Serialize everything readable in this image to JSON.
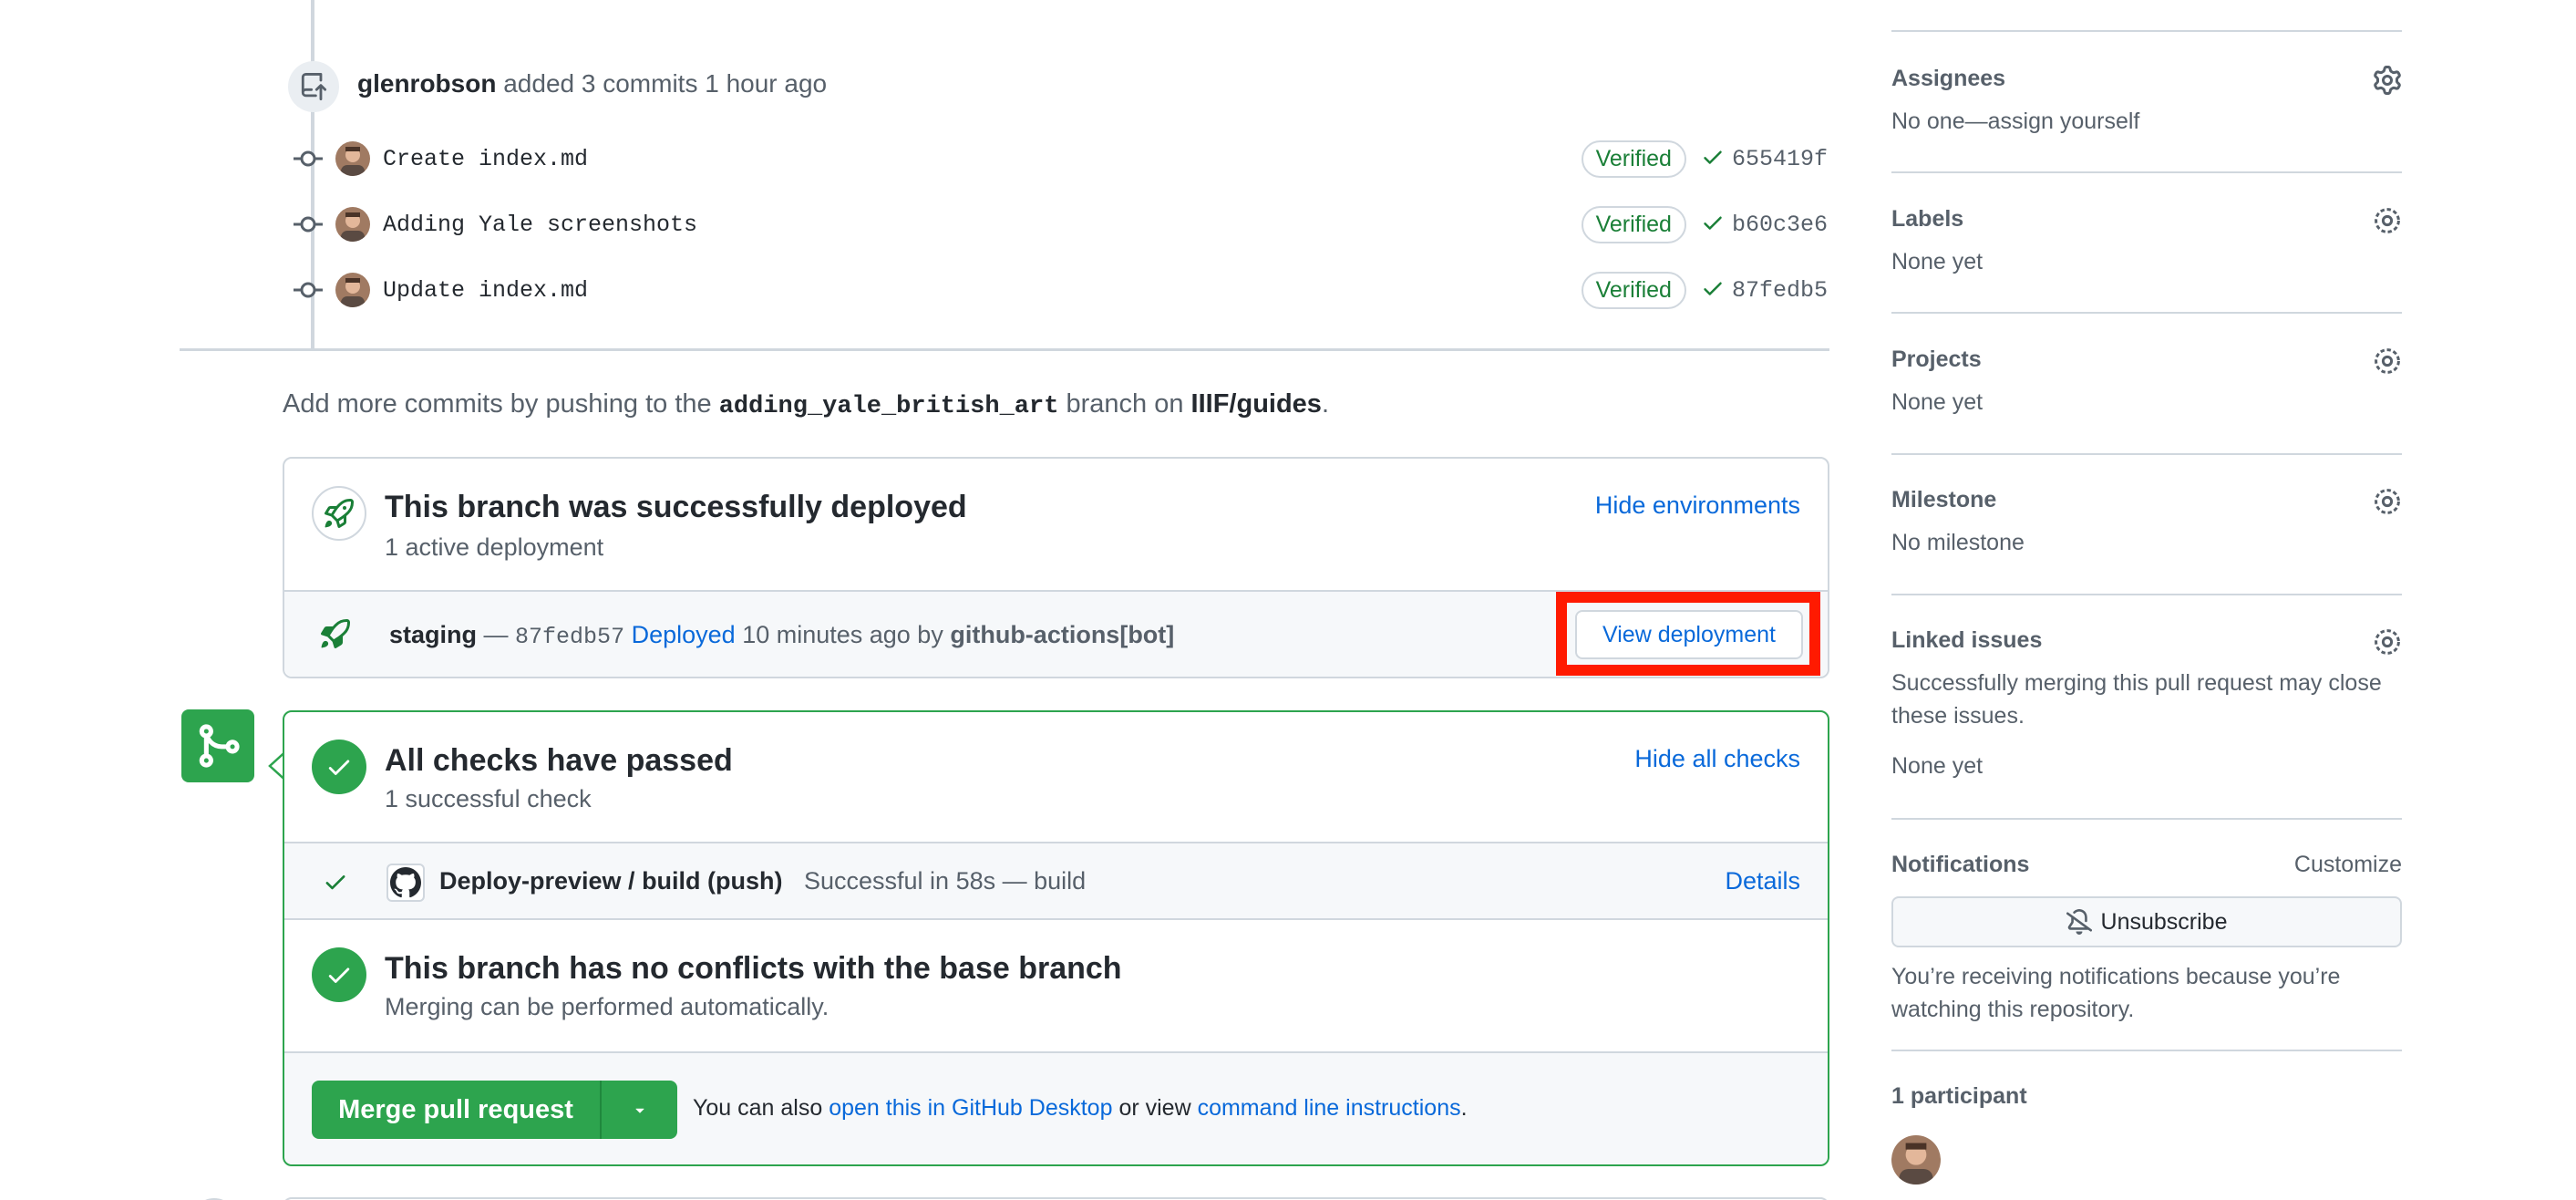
{
  "timeline": {
    "event": {
      "user": "glenrobson",
      "text": "added 3 commits",
      "time": "1 hour ago"
    },
    "commits": [
      {
        "message": "Create index.md",
        "badge": "Verified",
        "sha": "655419f"
      },
      {
        "message": "Adding Yale screenshots",
        "badge": "Verified",
        "sha": "b60c3e6"
      },
      {
        "message": "Update index.md",
        "badge": "Verified",
        "sha": "87fedb5"
      }
    ]
  },
  "note": {
    "prefix": "Add more commits by pushing to the",
    "branch": "adding_yale_british_art",
    "middle": "branch on",
    "repo": "IIIF/guides",
    "suffix": "."
  },
  "deploy": {
    "title": "This branch was successfully deployed",
    "subtitle": "1 active deployment",
    "hide_label": "Hide environments",
    "env": "staging",
    "dash": "—",
    "sha": "87fedb57",
    "status": "Deployed",
    "when": "10 minutes ago by",
    "actor": "github-actions[bot]",
    "view_label": "View deployment"
  },
  "checks": {
    "title": "All checks have passed",
    "subtitle": "1 successful check",
    "hide_label": "Hide all checks",
    "check_name": "Deploy-preview / build (push)",
    "check_status": "Successful in 58s — build",
    "details_label": "Details",
    "conflicts_title": "This branch has no conflicts with the base branch",
    "conflicts_sub": "Merging can be performed automatically.",
    "merge_label": "Merge pull request",
    "also_prefix": "You can also",
    "desktop_link": "open this in GitHub Desktop",
    "also_middle": "or view",
    "cli_link": "command line instructions",
    "also_suffix": "."
  },
  "sidebar": {
    "assignees": {
      "label": "Assignees",
      "value": "No one—assign yourself"
    },
    "labels": {
      "label": "Labels",
      "value": "None yet"
    },
    "projects": {
      "label": "Projects",
      "value": "None yet"
    },
    "milestone": {
      "label": "Milestone",
      "value": "No milestone"
    },
    "linked": {
      "label": "Linked issues",
      "desc_line1": "Successfully merging this pull request may close",
      "desc_line2": "these issues.",
      "value": "None yet"
    },
    "notifications": {
      "label": "Notifications",
      "customize": "Customize",
      "button": "Unsubscribe",
      "desc_line1": "You’re receiving notifications because you’re",
      "desc_line2": "watching this repository."
    },
    "participants": {
      "label": "1 participant"
    }
  },
  "colors": {
    "accent": "#0969da",
    "success": "#2da44e",
    "highlight": "#ff1a00"
  }
}
